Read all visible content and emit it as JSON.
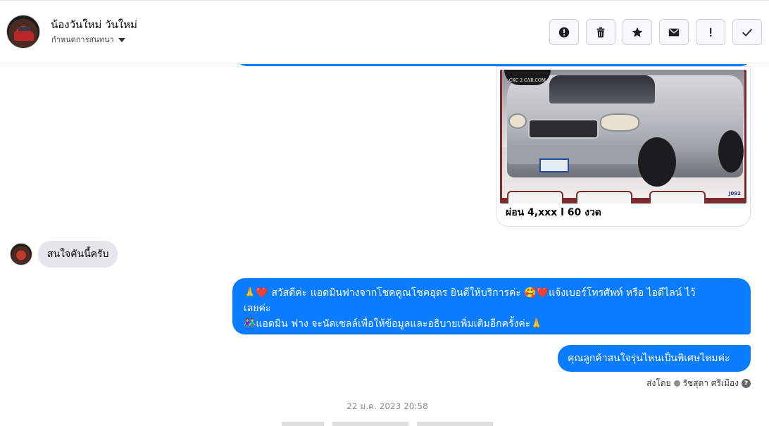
{
  "header": {
    "contact_name": "น้องวันใหม่ วันใหม่",
    "subtitle": "กำหนดการสนทนา",
    "tools": [
      {
        "icon": "alert-circle-icon"
      },
      {
        "icon": "trash-icon"
      },
      {
        "icon": "star-icon"
      },
      {
        "icon": "mail-icon"
      },
      {
        "icon": "exclamation-icon"
      },
      {
        "icon": "check-icon"
      }
    ]
  },
  "thread": {
    "card": {
      "logo_text": "CKC 2 CAR.COM",
      "photo_code": "J092",
      "caption": "ผ่อน 4,xxx l 60 งวด"
    },
    "incoming_message": "สนใจคันนี้ครับ",
    "outgoing_message_1_line_1": "🙏❤️ สวัสดีค่ะ แอดมินฟางจากโชคคูณโชคอุดร ยินดีให้บริการค่ะ 🥰❤️แจ้งเบอร์โทรศัพท์ หรือ ไอดีไลน์ ไว้",
    "outgoing_message_1_line_2": "เลยค่ะ",
    "outgoing_message_1_line_3": "👫แอดมิน ฟาง จะนัดเซลล์เพื่อให้ข้อมูลและอธิบายเพิ่มเติมอีกครั้งค่ะ🙏",
    "outgoing_message_2": "คุณลูกค้าสนใจรุ่นไหนเป็นพิเศษไหมค่ะ",
    "sent_by_label": "ส่งโดย",
    "sent_by_name": "รัชสุดา ศรีเมือง",
    "timestamp": "22 ม.ค. 2023 20:58"
  },
  "colors": {
    "outgoing_bubble": "#0a7cff",
    "incoming_bubble": "#e4e6eb"
  }
}
